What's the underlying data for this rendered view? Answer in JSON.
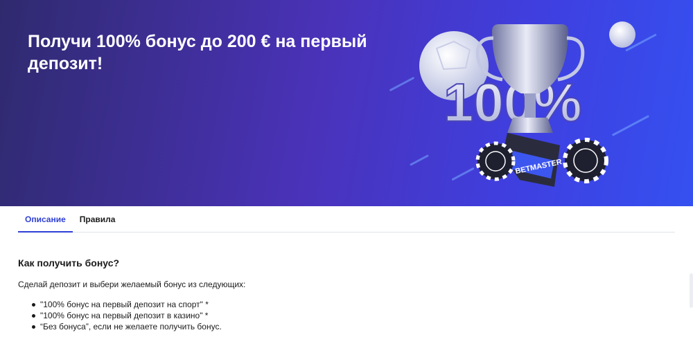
{
  "banner": {
    "title": "Получи 100% бонус до 200 € на первый депозит!",
    "art": {
      "percent_text": "100%",
      "brand_text": "BETMASTER"
    },
    "colors": {
      "background_start": "#2f2a6e",
      "background_end": "#3550f0",
      "accent": "#2f3fd6"
    }
  },
  "tabs": [
    {
      "label": "Описание",
      "active": true
    },
    {
      "label": "Правила",
      "active": false
    }
  ],
  "content": {
    "heading": "Как получить бонус?",
    "intro": "Сделай депозит и выбери желаемый бонус из следующих:",
    "items": [
      "\"100% бонус на первый депозит на спорт\" *",
      "\"100% бонус на первый депозит в казино\" *",
      "“Без бонуса”, если не желаете получить бонус."
    ]
  }
}
